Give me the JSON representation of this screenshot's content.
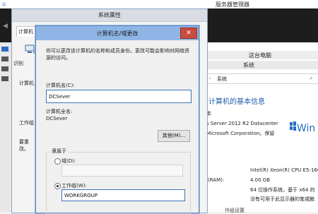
{
  "server_manager": {
    "title": "服务器管理器",
    "right_pane": {
      "section_title": "这台电脑",
      "system_header": "系统",
      "address": "系统",
      "heading": "计算机的基本信息",
      "line_fragment": "本",
      "os_line": "s Server 2012 R2 Datacenter",
      "copyright_line": "Microsoft Corporation。保留",
      "windows_logo_text": "Win",
      "specs": [
        {
          "label": "",
          "value": "Intel(R) Xeon(R) CPU E5-160"
        },
        {
          "label": "(RAM):",
          "value": "4.00 GB"
        },
        {
          "label": "",
          "value": "64 位操作系统，基于 x64 的"
        },
        {
          "label": "",
          "value": "没有可用于此显示器的笔或触"
        }
      ],
      "bottom_fragment": "作组设置"
    }
  },
  "system_properties": {
    "title": "系统属性",
    "tab_label": "计算机",
    "left_fragments": [
      "识别",
      "计算机",
      "工作组",
      "要重",
      "改。"
    ]
  },
  "dialog": {
    "title": "计算机名/域更改",
    "close_glyph": "✕",
    "description": "你可以更改该计算机的名称和成员身份。更改可能会影响对网络资源的访问。",
    "computer_name_label": "计算机名(C):",
    "computer_name_value": "DCSever",
    "full_name_label": "计算机全名:",
    "full_name_value": "DCSever",
    "other_button": "其他(M)...",
    "member_of_label": "隶属于",
    "domain_label": "域(D):",
    "domain_value": "",
    "workgroup_label": "工作组(W):",
    "workgroup_value": "WORKGROUP",
    "selected_membership": "workgroup"
  },
  "colors": {
    "title_bar": "#8eb5e6",
    "close_button": "#c74d3f",
    "accent_blue": "#1e5aa8"
  }
}
